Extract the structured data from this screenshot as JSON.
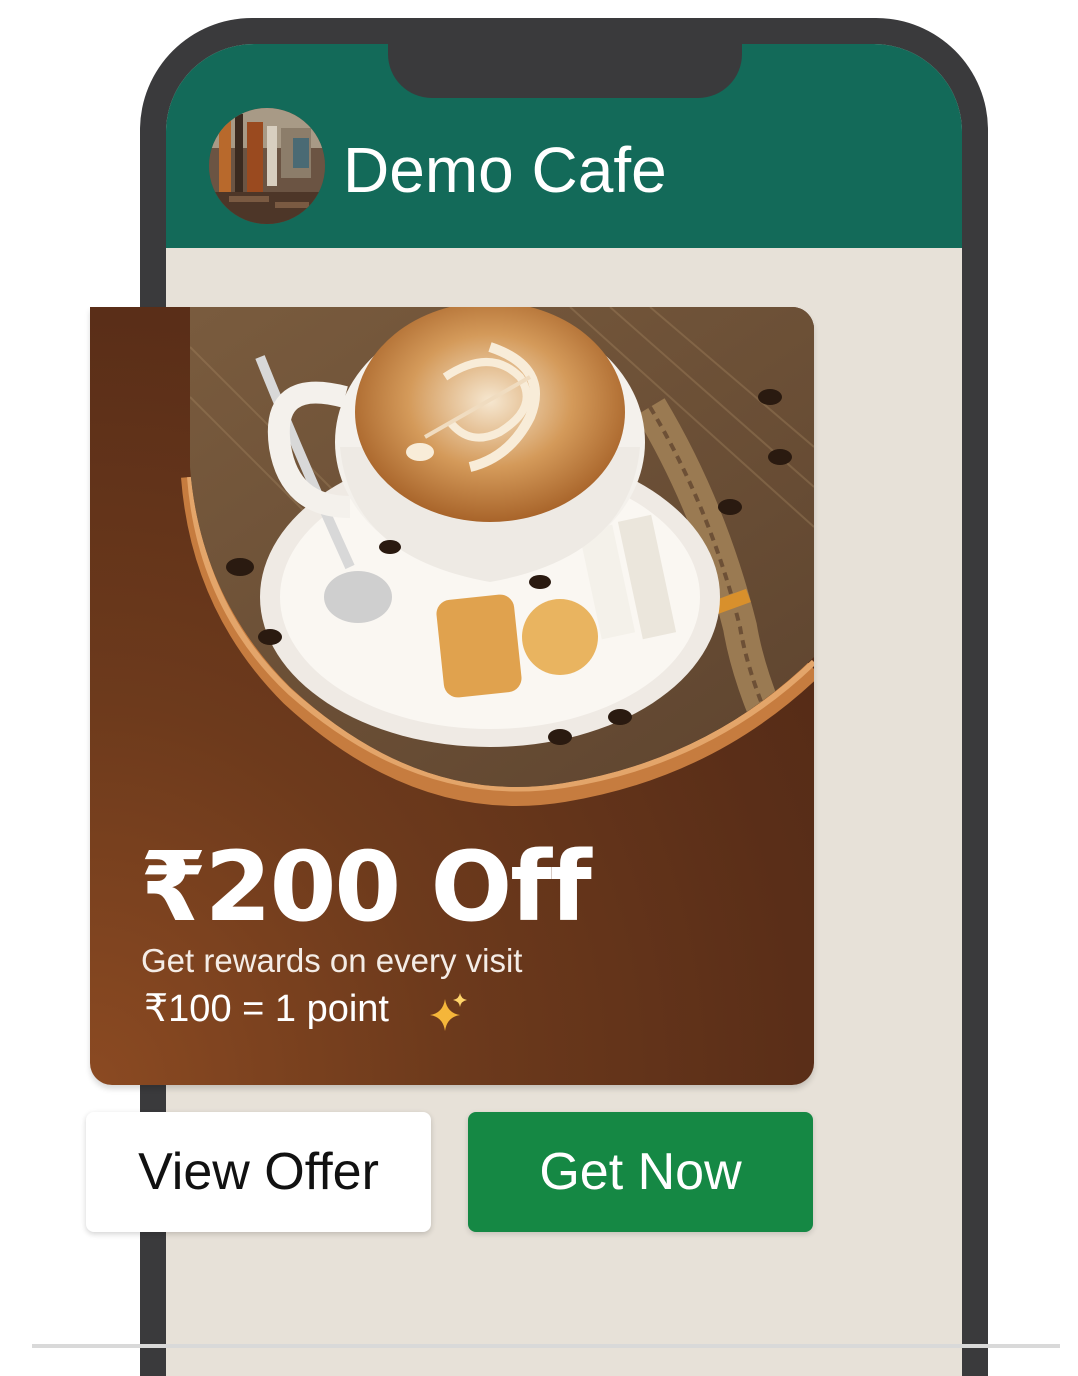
{
  "chat": {
    "title": "Demo Cafe",
    "avatar_icon": "cafe-interior-photo",
    "header_color": "#136a59"
  },
  "offer": {
    "title": "₹200 Off",
    "subtitle": "Get rewards on every visit",
    "points_text": "₹100 = 1 point",
    "sparkle_icon": "sparkles-icon",
    "image_icon": "latte-coffee-photo"
  },
  "buttons": {
    "view_offer": "View Offer",
    "get_now": "Get Now"
  },
  "colors": {
    "card_brown": "#5a2e18",
    "cta_green": "#158844",
    "chat_background": "#e7e1d8"
  }
}
